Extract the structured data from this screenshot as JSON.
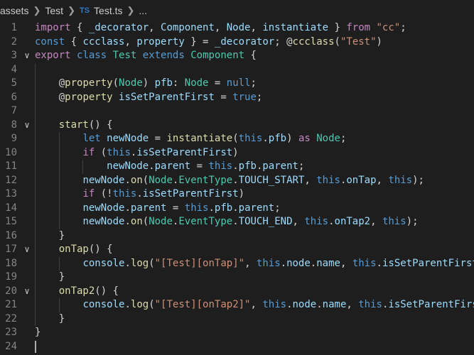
{
  "breadcrumb": {
    "items": [
      "assets",
      "Test",
      "Test.ts",
      "..."
    ],
    "file_icon_label": "TS"
  },
  "editor": {
    "language": "TypeScript",
    "lines": [
      {
        "n": "1",
        "fold": false,
        "tokens": [
          [
            "k",
            "import"
          ],
          [
            "p",
            " { "
          ],
          [
            "v",
            "_decorator"
          ],
          [
            "p",
            ", "
          ],
          [
            "v",
            "Component"
          ],
          [
            "p",
            ", "
          ],
          [
            "v",
            "Node"
          ],
          [
            "p",
            ", "
          ],
          [
            "v",
            "instantiate"
          ],
          [
            "p",
            " } "
          ],
          [
            "k",
            "from"
          ],
          [
            "p",
            " "
          ],
          [
            "s",
            "\"cc\""
          ],
          [
            "p",
            ";"
          ]
        ]
      },
      {
        "n": "2",
        "fold": false,
        "tokens": [
          [
            "b",
            "const"
          ],
          [
            "p",
            " { "
          ],
          [
            "v",
            "ccclass"
          ],
          [
            "p",
            ", "
          ],
          [
            "v",
            "property"
          ],
          [
            "p",
            " } = "
          ],
          [
            "v",
            "_decorator"
          ],
          [
            "p",
            "; @"
          ],
          [
            "f",
            "ccclass"
          ],
          [
            "p",
            "("
          ],
          [
            "s",
            "\"Test\""
          ],
          [
            "p",
            ")"
          ]
        ]
      },
      {
        "n": "3",
        "fold": true,
        "tokens": [
          [
            "k",
            "export"
          ],
          [
            "p",
            " "
          ],
          [
            "b",
            "class"
          ],
          [
            "p",
            " "
          ],
          [
            "t",
            "Test"
          ],
          [
            "p",
            " "
          ],
          [
            "b",
            "extends"
          ],
          [
            "p",
            " "
          ],
          [
            "t",
            "Component"
          ],
          [
            "p",
            " {"
          ]
        ]
      },
      {
        "n": "4",
        "fold": false,
        "tokens": []
      },
      {
        "n": "5",
        "fold": false,
        "tokens": [
          [
            "p",
            "    @"
          ],
          [
            "f",
            "property"
          ],
          [
            "p",
            "("
          ],
          [
            "t",
            "Node"
          ],
          [
            "p",
            ") "
          ],
          [
            "v",
            "pfb"
          ],
          [
            "p",
            ": "
          ],
          [
            "t",
            "Node"
          ],
          [
            "p",
            " = "
          ],
          [
            "b",
            "null"
          ],
          [
            "p",
            ";"
          ]
        ]
      },
      {
        "n": "6",
        "fold": false,
        "tokens": [
          [
            "p",
            "    @"
          ],
          [
            "f",
            "property"
          ],
          [
            "p",
            " "
          ],
          [
            "v",
            "isSetParentFirst"
          ],
          [
            "p",
            " = "
          ],
          [
            "b",
            "true"
          ],
          [
            "p",
            ";"
          ]
        ]
      },
      {
        "n": "7",
        "fold": false,
        "tokens": []
      },
      {
        "n": "8",
        "fold": true,
        "tokens": [
          [
            "p",
            "    "
          ],
          [
            "f",
            "start"
          ],
          [
            "p",
            "() {"
          ]
        ]
      },
      {
        "n": "9",
        "fold": false,
        "tokens": [
          [
            "p",
            "        "
          ],
          [
            "b",
            "let"
          ],
          [
            "p",
            " "
          ],
          [
            "v",
            "newNode"
          ],
          [
            "p",
            " = "
          ],
          [
            "f",
            "instantiate"
          ],
          [
            "p",
            "("
          ],
          [
            "b",
            "this"
          ],
          [
            "p",
            "."
          ],
          [
            "v",
            "pfb"
          ],
          [
            "p",
            ") "
          ],
          [
            "k",
            "as"
          ],
          [
            "p",
            " "
          ],
          [
            "t",
            "Node"
          ],
          [
            "p",
            ";"
          ]
        ]
      },
      {
        "n": "10",
        "fold": false,
        "tokens": [
          [
            "p",
            "        "
          ],
          [
            "k",
            "if"
          ],
          [
            "p",
            " ("
          ],
          [
            "b",
            "this"
          ],
          [
            "p",
            "."
          ],
          [
            "v",
            "isSetParentFirst"
          ],
          [
            "p",
            ")"
          ]
        ]
      },
      {
        "n": "11",
        "fold": false,
        "tokens": [
          [
            "p",
            "            "
          ],
          [
            "v",
            "newNode"
          ],
          [
            "p",
            "."
          ],
          [
            "v",
            "parent"
          ],
          [
            "p",
            " = "
          ],
          [
            "b",
            "this"
          ],
          [
            "p",
            "."
          ],
          [
            "v",
            "pfb"
          ],
          [
            "p",
            "."
          ],
          [
            "v",
            "parent"
          ],
          [
            "p",
            ";"
          ]
        ]
      },
      {
        "n": "12",
        "fold": false,
        "tokens": [
          [
            "p",
            "        "
          ],
          [
            "v",
            "newNode"
          ],
          [
            "p",
            "."
          ],
          [
            "f",
            "on"
          ],
          [
            "p",
            "("
          ],
          [
            "t",
            "Node"
          ],
          [
            "p",
            "."
          ],
          [
            "t",
            "EventType"
          ],
          [
            "p",
            "."
          ],
          [
            "v",
            "TOUCH_START"
          ],
          [
            "p",
            ", "
          ],
          [
            "b",
            "this"
          ],
          [
            "p",
            "."
          ],
          [
            "v",
            "onTap"
          ],
          [
            "p",
            ", "
          ],
          [
            "b",
            "this"
          ],
          [
            "p",
            ");"
          ]
        ]
      },
      {
        "n": "13",
        "fold": false,
        "tokens": [
          [
            "p",
            "        "
          ],
          [
            "k",
            "if"
          ],
          [
            "p",
            " (!"
          ],
          [
            "b",
            "this"
          ],
          [
            "p",
            "."
          ],
          [
            "v",
            "isSetParentFirst"
          ],
          [
            "p",
            ")"
          ]
        ]
      },
      {
        "n": "14",
        "fold": false,
        "tokens": [
          [
            "p",
            "        "
          ],
          [
            "v",
            "newNode"
          ],
          [
            "p",
            "."
          ],
          [
            "v",
            "parent"
          ],
          [
            "p",
            " = "
          ],
          [
            "b",
            "this"
          ],
          [
            "p",
            "."
          ],
          [
            "v",
            "pfb"
          ],
          [
            "p",
            "."
          ],
          [
            "v",
            "parent"
          ],
          [
            "p",
            ";"
          ]
        ]
      },
      {
        "n": "15",
        "fold": false,
        "tokens": [
          [
            "p",
            "        "
          ],
          [
            "v",
            "newNode"
          ],
          [
            "p",
            "."
          ],
          [
            "f",
            "on"
          ],
          [
            "p",
            "("
          ],
          [
            "t",
            "Node"
          ],
          [
            "p",
            "."
          ],
          [
            "t",
            "EventType"
          ],
          [
            "p",
            "."
          ],
          [
            "v",
            "TOUCH_END"
          ],
          [
            "p",
            ", "
          ],
          [
            "b",
            "this"
          ],
          [
            "p",
            "."
          ],
          [
            "v",
            "onTap2"
          ],
          [
            "p",
            ", "
          ],
          [
            "b",
            "this"
          ],
          [
            "p",
            ");"
          ]
        ]
      },
      {
        "n": "16",
        "fold": false,
        "tokens": [
          [
            "p",
            "    }"
          ]
        ]
      },
      {
        "n": "17",
        "fold": true,
        "tokens": [
          [
            "p",
            "    "
          ],
          [
            "f",
            "onTap"
          ],
          [
            "p",
            "() {"
          ]
        ]
      },
      {
        "n": "18",
        "fold": false,
        "tokens": [
          [
            "p",
            "        "
          ],
          [
            "v",
            "console"
          ],
          [
            "p",
            "."
          ],
          [
            "f",
            "log"
          ],
          [
            "p",
            "("
          ],
          [
            "s",
            "\"[Test][onTap]\""
          ],
          [
            "p",
            ", "
          ],
          [
            "b",
            "this"
          ],
          [
            "p",
            "."
          ],
          [
            "v",
            "node"
          ],
          [
            "p",
            "."
          ],
          [
            "v",
            "name"
          ],
          [
            "p",
            ", "
          ],
          [
            "b",
            "this"
          ],
          [
            "p",
            "."
          ],
          [
            "v",
            "isSetParentFirst"
          ],
          [
            "p",
            ");"
          ]
        ]
      },
      {
        "n": "19",
        "fold": false,
        "tokens": [
          [
            "p",
            "    }"
          ]
        ]
      },
      {
        "n": "20",
        "fold": true,
        "tokens": [
          [
            "p",
            "    "
          ],
          [
            "f",
            "onTap2"
          ],
          [
            "p",
            "() {"
          ]
        ]
      },
      {
        "n": "21",
        "fold": false,
        "tokens": [
          [
            "p",
            "        "
          ],
          [
            "v",
            "console"
          ],
          [
            "p",
            "."
          ],
          [
            "f",
            "log"
          ],
          [
            "p",
            "("
          ],
          [
            "s",
            "\"[Test][onTap2]\""
          ],
          [
            "p",
            ", "
          ],
          [
            "b",
            "this"
          ],
          [
            "p",
            "."
          ],
          [
            "v",
            "node"
          ],
          [
            "p",
            "."
          ],
          [
            "v",
            "name"
          ],
          [
            "p",
            ", "
          ],
          [
            "b",
            "this"
          ],
          [
            "p",
            "."
          ],
          [
            "v",
            "isSetParentFirst"
          ],
          [
            "p",
            ");"
          ]
        ]
      },
      {
        "n": "22",
        "fold": false,
        "tokens": [
          [
            "p",
            "    }"
          ]
        ]
      },
      {
        "n": "23",
        "fold": false,
        "tokens": [
          [
            "p",
            "}"
          ]
        ]
      },
      {
        "n": "24",
        "fold": false,
        "tokens": []
      }
    ]
  }
}
